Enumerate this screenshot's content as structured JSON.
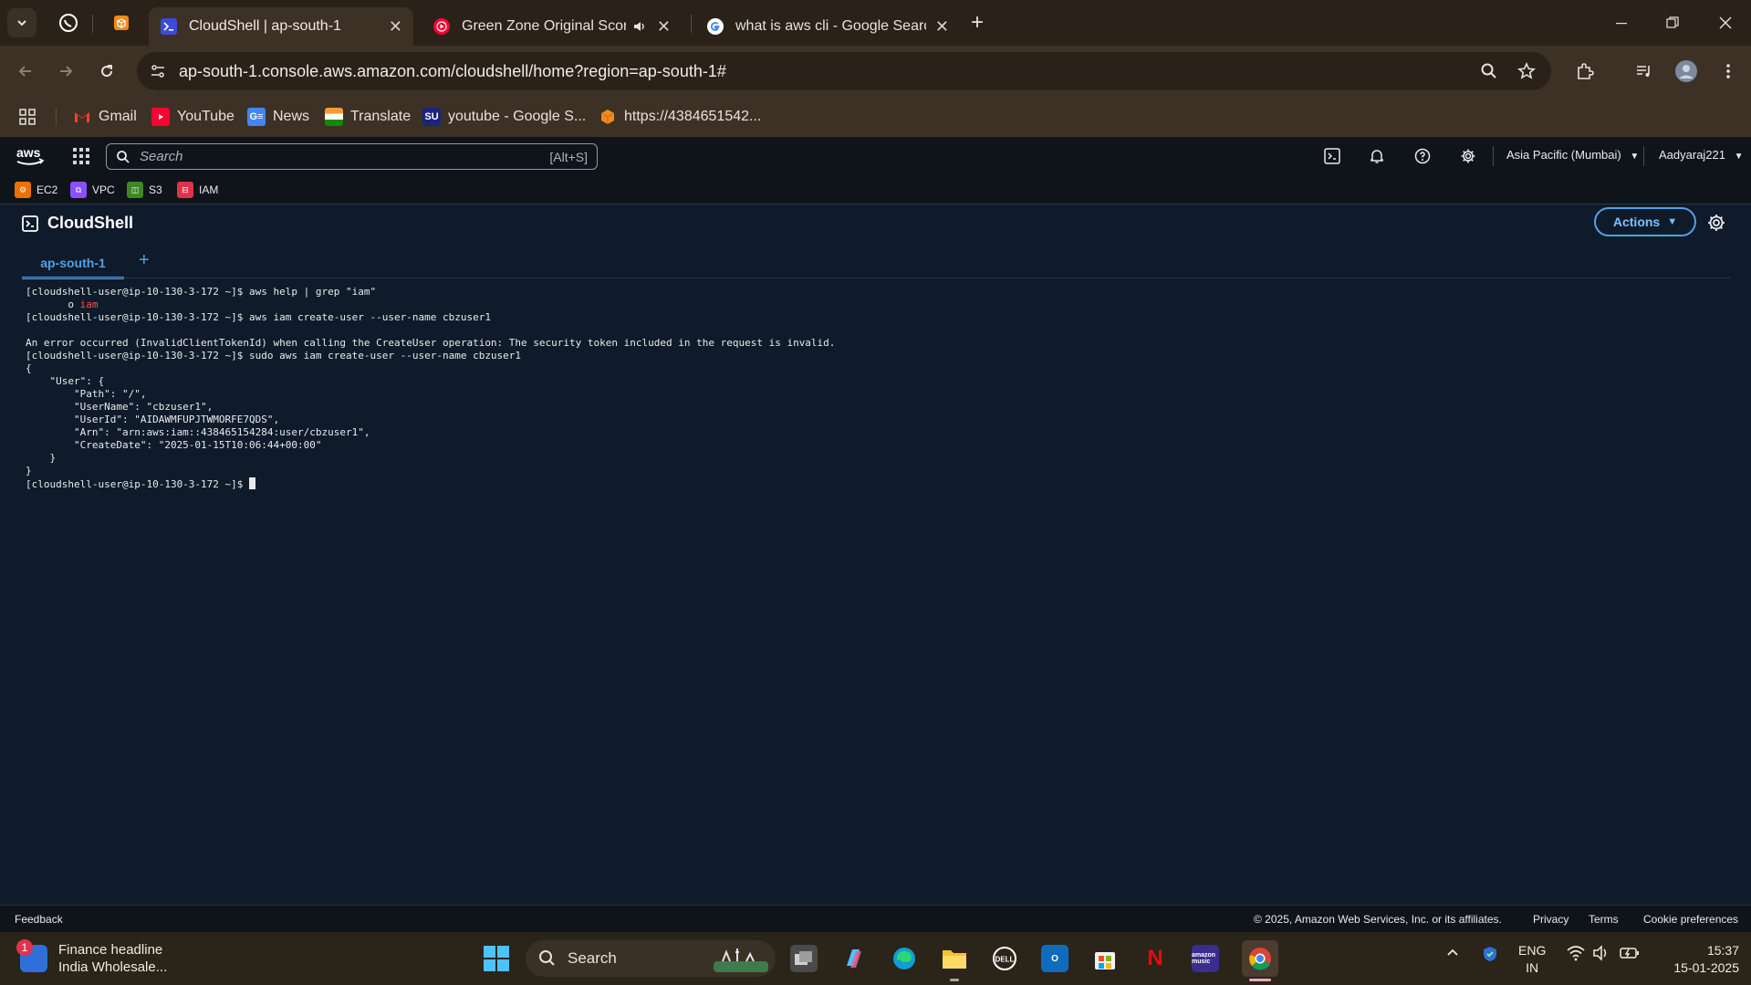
{
  "browser": {
    "tabs": [
      {
        "label": "CloudShell | ap-south-1",
        "active": true
      },
      {
        "label": "Green Zone Original Score",
        "active": false,
        "audio": true
      },
      {
        "label": "what is aws cli - Google Search",
        "active": false
      }
    ],
    "url": "ap-south-1.console.aws.amazon.com/cloudshell/home?region=ap-south-1#",
    "bookmarks": [
      {
        "label": "Gmail"
      },
      {
        "label": "YouTube"
      },
      {
        "label": "News"
      },
      {
        "label": "Translate"
      },
      {
        "label": "youtube - Google S..."
      },
      {
        "label": "https://4384651542..."
      }
    ]
  },
  "aws": {
    "search_placeholder": "Search",
    "search_shortcut": "[Alt+S]",
    "region": "Asia Pacific (Mumbai)",
    "account": "Aadyaraj221",
    "favorites": [
      {
        "label": "EC2",
        "color": "#ed7100"
      },
      {
        "label": "VPC",
        "color": "#8c4fff"
      },
      {
        "label": "S3",
        "color": "#3f8624"
      },
      {
        "label": "IAM",
        "color": "#dd344c"
      }
    ]
  },
  "cloudshell": {
    "title": "CloudShell",
    "actions_label": "Actions",
    "tab_label": "ap-south-1",
    "add_tab": "+",
    "terminal_lines": [
      {
        "text": "[cloudshell-user@ip-10-130-3-172 ~]$ aws help | grep \"iam\""
      },
      {
        "prefix": "       o ",
        "text": "iam",
        "red": true
      },
      {
        "text": "[cloudshell-user@ip-10-130-3-172 ~]$ aws iam create-user --user-name cbzuser1"
      },
      {
        "text": ""
      },
      {
        "text": "An error occurred (InvalidClientTokenId) when calling the CreateUser operation: The security token included in the request is invalid."
      },
      {
        "text": "[cloudshell-user@ip-10-130-3-172 ~]$ sudo aws iam create-user --user-name cbzuser1"
      },
      {
        "text": "{"
      },
      {
        "text": "    \"User\": {"
      },
      {
        "text": "        \"Path\": \"/\","
      },
      {
        "text": "        \"UserName\": \"cbzuser1\","
      },
      {
        "text": "        \"UserId\": \"AIDAWMFUPJTWMORFE7QDS\","
      },
      {
        "text": "        \"Arn\": \"arn:aws:iam::438465154284:user/cbzuser1\","
      },
      {
        "text": "        \"CreateDate\": \"2025-01-15T10:06:44+00:00\""
      },
      {
        "text": "    }"
      },
      {
        "text": "}"
      },
      {
        "text": "[cloudshell-user@ip-10-130-3-172 ~]$ ",
        "cursor": true
      }
    ]
  },
  "footer": {
    "feedback": "Feedback",
    "copyright": "© 2025, Amazon Web Services, Inc. or its affiliates.",
    "privacy": "Privacy",
    "terms": "Terms",
    "cookies": "Cookie preferences"
  },
  "taskbar": {
    "widget_title": "Finance headline",
    "widget_subtitle": "India Wholesale...",
    "widget_badge": "1",
    "search_label": "Search",
    "lang_top": "ENG",
    "lang_bottom": "IN",
    "time": "15:37",
    "date": "15-01-2025"
  }
}
